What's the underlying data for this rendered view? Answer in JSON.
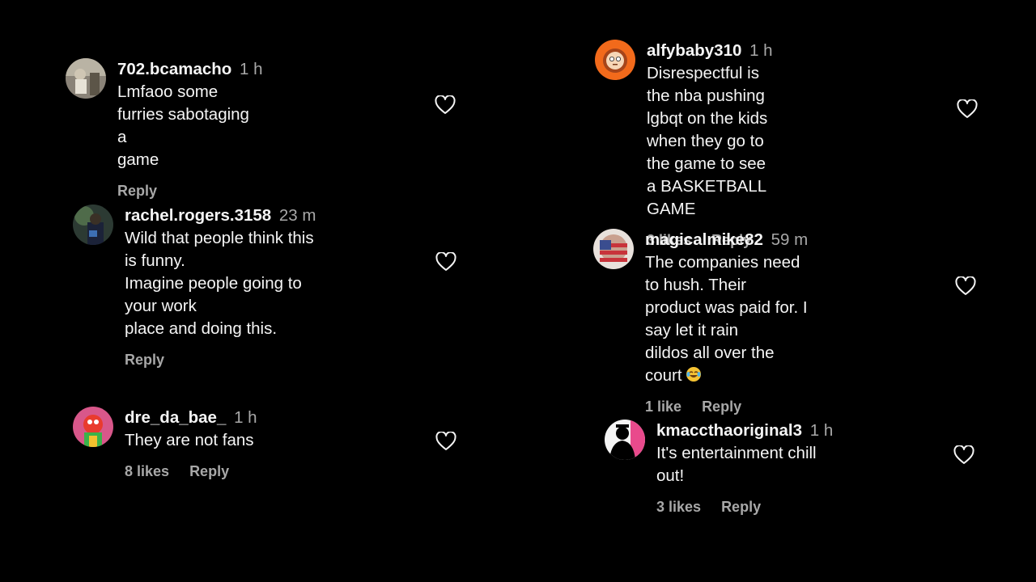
{
  "comments": [
    {
      "username": "702.bcamacho",
      "time": "1 h",
      "text": "Lmfaoo some furries sabotaging a\ngame",
      "likes": "",
      "reply": "Reply"
    },
    {
      "username": "rachel.rogers.3158",
      "time": "23 m",
      "text": "Wild that people think this is funny.\nImagine people going to your work\nplace and doing this.",
      "likes": "",
      "reply": "Reply"
    },
    {
      "username": "dre_da_bae_",
      "time": "1 h",
      "text": "They are not fans",
      "likes": "8 likes",
      "reply": "Reply"
    },
    {
      "username": "alfybaby310",
      "time": "1 h",
      "text": "Disrespectful is the nba pushing\nlgbqt on the kids when they go to\nthe game to see a BASKETBALL\nGAME",
      "likes": "3 likes",
      "reply": "Reply"
    },
    {
      "username": "magicalmike82",
      "time": "59 m",
      "text": "The companies need to hush. Their\nproduct was paid for. I say let it rain\ndildos all over the court",
      "emoji": "face-with-tears-of-joy-emoji",
      "likes": "1 like",
      "reply": "Reply"
    },
    {
      "username": "kmaccthaoriginal3",
      "time": "1 h",
      "text": "It's entertainment chill out!",
      "likes": "3 likes",
      "reply": "Reply"
    }
  ],
  "icons": {
    "like": "heart-outline-icon"
  },
  "colors": {
    "background": "#000000",
    "text": "#f5f5f5",
    "muted": "#a8a8a8"
  }
}
